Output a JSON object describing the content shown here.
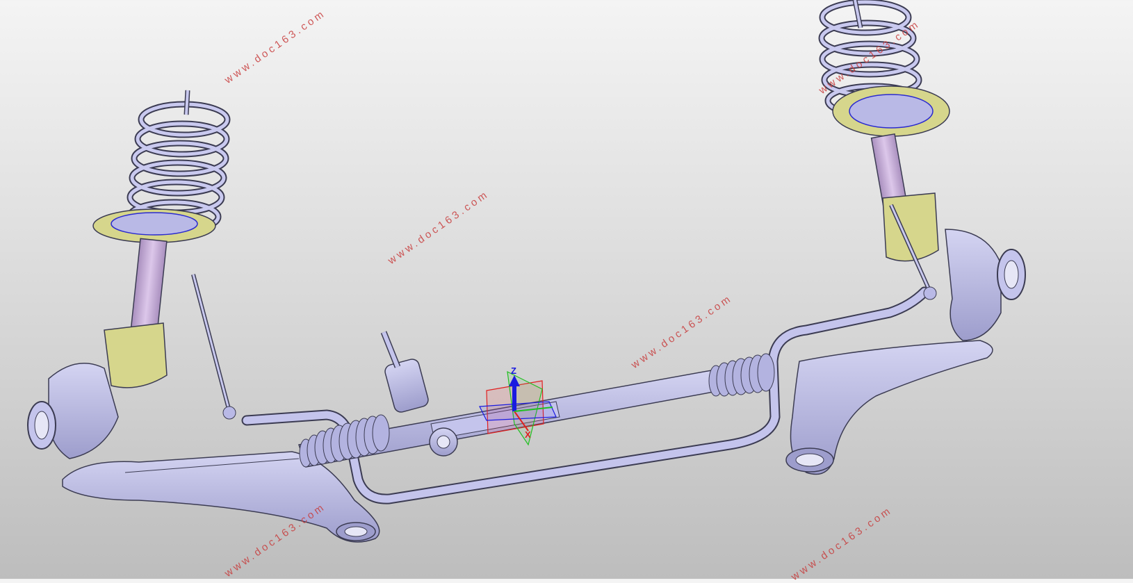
{
  "scene": {
    "watermark_text": "www.doc163.com",
    "compass": {
      "z_label": "Z",
      "x_label": "X"
    },
    "colors": {
      "background_top": "#f4f4f4",
      "background_bottom": "#bdbdbd",
      "metal_fill": "#b9b9e6",
      "metal_edge": "#3b3b52",
      "strut_mount": "#d6d68c",
      "shock_body": "#cbb3d8",
      "watermark": "#c83c3c",
      "axis_z": "#1a1ae0",
      "axis_x": "#e02020",
      "axis_y": "#20c020"
    }
  }
}
